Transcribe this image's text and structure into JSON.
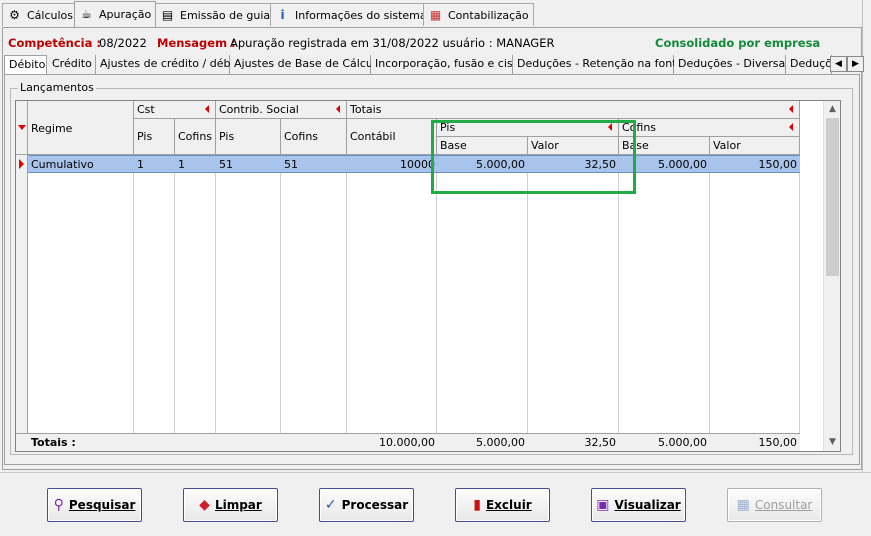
{
  "top_tabs": [
    {
      "label": "Cálculos",
      "icon": "calculator-icon"
    },
    {
      "label": "Apuração",
      "icon": "coffee-icon"
    },
    {
      "label": "Emissão de guias",
      "icon": "document-icon"
    },
    {
      "label": "Informações do sistema",
      "icon": "info-icon"
    },
    {
      "label": "Contabilização",
      "icon": "calendar-icon"
    }
  ],
  "info": {
    "competencia_label": "Competência :",
    "competencia_value": "08/2022",
    "mensagem_label": "Mensagem :",
    "mensagem_value": "Apuração registrada em 31/08/2022 usuário : MANAGER",
    "consolidado": "Consolidado por empresa"
  },
  "sub_tabs": [
    "Débito",
    "Crédito",
    "Ajustes de crédito / débito",
    "Ajustes de Base de Cálculo",
    "Incorporação, fusão e cisão",
    "Deduções - Retenção na fonte",
    "Deduções - Diversas",
    "Deduçõ"
  ],
  "group_title": "Lançamentos",
  "grid": {
    "headers": {
      "regime": "Regime",
      "cst": "Cst",
      "cst_pis": "Pis",
      "cst_cofins": "Cofins",
      "contrib": "Contrib. Social",
      "contrib_pis": "Pis",
      "contrib_cofins": "Cofins",
      "totais": "Totais",
      "contabil": "Contábil",
      "pis": "Pis",
      "pis_base": "Base",
      "pis_valor": "Valor",
      "cofins": "Cofins",
      "cofins_base": "Base",
      "cofins_valor": "Valor"
    },
    "row": {
      "regime": "Cumulativo",
      "cst_pis": "1",
      "cst_cofins": "1",
      "contrib_pis": "51",
      "contrib_cofins": "51",
      "contabil": "10000",
      "pis_base": "5.000,00",
      "pis_valor": "32,50",
      "cofins_base": "5.000,00",
      "cofins_valor": "150,00"
    },
    "totals": {
      "label": "Totais :",
      "contabil": "10.000,00",
      "pis_base": "5.000,00",
      "pis_valor": "32,50",
      "cofins_base": "5.000,00",
      "cofins_valor": "150,00"
    }
  },
  "buttons": {
    "pesquisar": "Pesquisar",
    "limpar": "Limpar",
    "processar": "Processar",
    "excluir": "Excluir",
    "visualizar": "Visualizar",
    "consultar": "Consultar"
  },
  "colors": {
    "label_red": "#c00000",
    "label_green": "#128a3a",
    "selected_row": "#a9c4ec",
    "highlight": "#22aa44"
  }
}
